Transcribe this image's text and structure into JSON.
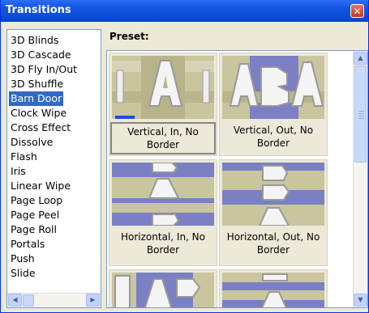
{
  "window": {
    "title": "Transitions",
    "close_symbol": "✕"
  },
  "list": {
    "items": [
      "3D Blinds",
      "3D Cascade",
      "3D Fly In/Out",
      "3D Shuffle",
      "Barn Door",
      "Clock Wipe",
      "Cross Effect",
      "Dissolve",
      "Flash",
      "Iris",
      "Linear Wipe",
      "Page Loop",
      "Page Peel",
      "Page Roll",
      "Portals",
      "Push",
      "Slide"
    ],
    "selected": "Barn Door"
  },
  "preset": {
    "label": "Preset:",
    "tiles": [
      {
        "caption": "Vertical, In, No Border",
        "selected": true,
        "thumb_letters": [
          "A"
        ]
      },
      {
        "caption": "Vertical, Out, No Border",
        "selected": false,
        "thumb_letters": [
          "A",
          "B"
        ]
      },
      {
        "caption": "Horizontal, In, No Border",
        "selected": false,
        "thumb_letters": [
          "B",
          "A"
        ]
      },
      {
        "caption": "Horizontal, Out, No Border",
        "selected": false,
        "thumb_letters": [
          "B",
          "A"
        ]
      }
    ]
  },
  "colors": {
    "title_bar": "#0b4fd9",
    "selection": "#316ac5",
    "thumb_bg": "#c7c49c",
    "thumb_band": "#7b7fc4"
  }
}
